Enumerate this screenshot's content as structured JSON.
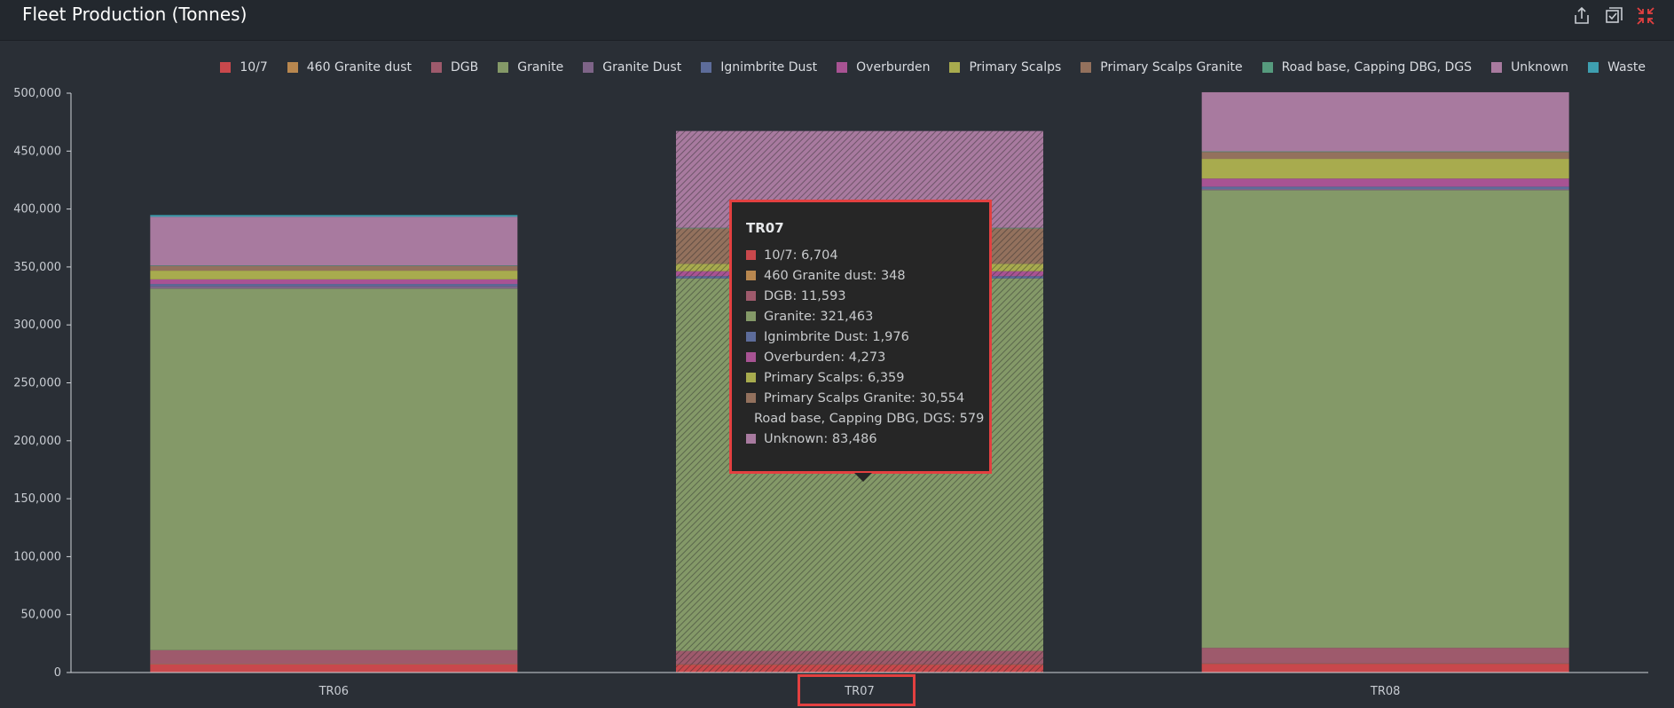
{
  "header": {
    "title": "Fleet Production (Tonnes)"
  },
  "toolbar": {
    "icons": [
      "share-icon",
      "select-icon",
      "collapse-icon"
    ],
    "icon_color": "#c8ccd2",
    "collapse_icon_color": "#e34040"
  },
  "chart_data": {
    "type": "bar",
    "stacked": true,
    "categories": [
      "TR06",
      "TR07",
      "TR08"
    ],
    "ylim": [
      0,
      500000
    ],
    "yticks": [
      0,
      50000,
      100000,
      150000,
      200000,
      250000,
      300000,
      350000,
      400000,
      450000,
      500000
    ],
    "ytick_labels": [
      "0",
      "50,000",
      "100,000",
      "150,000",
      "200,000",
      "250,000",
      "300,000",
      "350,000",
      "400,000",
      "450,000",
      "500,000"
    ],
    "legend_position": "top-right",
    "grid": false,
    "series": [
      {
        "name": "10/7",
        "color": "#c9484c",
        "values": [
          7000,
          6704,
          7500
        ]
      },
      {
        "name": "460 Granite dust",
        "color": "#b8874f",
        "values": [
          300,
          348,
          300
        ]
      },
      {
        "name": "DGB",
        "color": "#9e5a6c",
        "values": [
          12000,
          11593,
          13500
        ]
      },
      {
        "name": "Granite",
        "color": "#849968",
        "values": [
          312000,
          321463,
          395000
        ]
      },
      {
        "name": "Granite Dust",
        "color": "#7e6488",
        "values": [
          2000,
          0,
          1000
        ]
      },
      {
        "name": "Ignimbrite Dust",
        "color": "#5d6c9a",
        "values": [
          2000,
          1976,
          2000
        ]
      },
      {
        "name": "Overburden",
        "color": "#a85393",
        "values": [
          4000,
          4273,
          7000
        ]
      },
      {
        "name": "Primary Scalps",
        "color": "#a8ab4e",
        "values": [
          7500,
          6359,
          17000
        ]
      },
      {
        "name": "Primary Scalps Granite",
        "color": "#93715d",
        "values": [
          4000,
          30554,
          6000
        ]
      },
      {
        "name": "Road base, Capping DBG, DGS",
        "color": "#569b7e",
        "values": [
          500,
          579,
          500
        ]
      },
      {
        "name": "Unknown",
        "color": "#a87a9f",
        "values": [
          42000,
          83486,
          51000
        ]
      },
      {
        "name": "Waste",
        "color": "#3e9fb0",
        "values": [
          1500,
          0,
          0
        ]
      }
    ]
  },
  "tooltip": {
    "title": "TR07",
    "rows": [
      {
        "label": "10/7",
        "value": "6,704",
        "color": "#c9484c"
      },
      {
        "label": "460 Granite dust",
        "value": "348",
        "color": "#b8874f"
      },
      {
        "label": "DGB",
        "value": "11,593",
        "color": "#9e5a6c"
      },
      {
        "label": "Granite",
        "value": "321,463",
        "color": "#849968"
      },
      {
        "label": "Ignimbrite Dust",
        "value": "1,976",
        "color": "#5d6c9a"
      },
      {
        "label": "Overburden",
        "value": "4,273",
        "color": "#a85393"
      },
      {
        "label": "Primary Scalps",
        "value": "6,359",
        "color": "#a8ab4e"
      },
      {
        "label": "Primary Scalps Granite",
        "value": "30,554",
        "color": "#93715d"
      },
      {
        "label": "Road base, Capping DBG, DGS",
        "value": "579",
        "color": "#569b7e"
      },
      {
        "label": "Unknown",
        "value": "83,486",
        "color": "#a87a9f"
      }
    ]
  },
  "selected_category": "TR07",
  "highlight_color": "#e34040"
}
